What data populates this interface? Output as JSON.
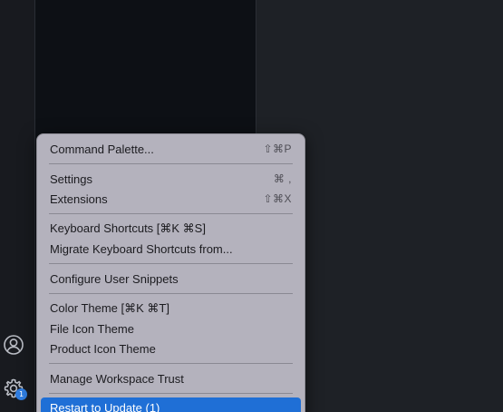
{
  "colors": {
    "menu_bg": "#b4b2bd",
    "highlight": "#1f6fd6",
    "badge": "#2f7de1",
    "sidebar_bg": "#0d1015",
    "editor_bg": "#1e2126"
  },
  "activity_bar": {
    "accounts_icon": "account-icon",
    "manage_icon": "gear-icon",
    "manage_badge": "1"
  },
  "menu": {
    "items": [
      {
        "label": "Command Palette...",
        "shortcut": "⇧⌘P"
      },
      {
        "label": "Settings",
        "shortcut": "⌘ ,"
      },
      {
        "label": "Extensions",
        "shortcut": "⇧⌘X"
      },
      {
        "label": "Keyboard Shortcuts [⌘K ⌘S]",
        "shortcut": ""
      },
      {
        "label": "Migrate Keyboard Shortcuts from...",
        "shortcut": ""
      },
      {
        "label": "Configure User Snippets",
        "shortcut": ""
      },
      {
        "label": "Color Theme [⌘K ⌘T]",
        "shortcut": ""
      },
      {
        "label": "File Icon Theme",
        "shortcut": ""
      },
      {
        "label": "Product Icon Theme",
        "shortcut": ""
      },
      {
        "label": "Manage Workspace Trust",
        "shortcut": ""
      },
      {
        "label": "Restart to Update (1)",
        "shortcut": ""
      }
    ]
  }
}
